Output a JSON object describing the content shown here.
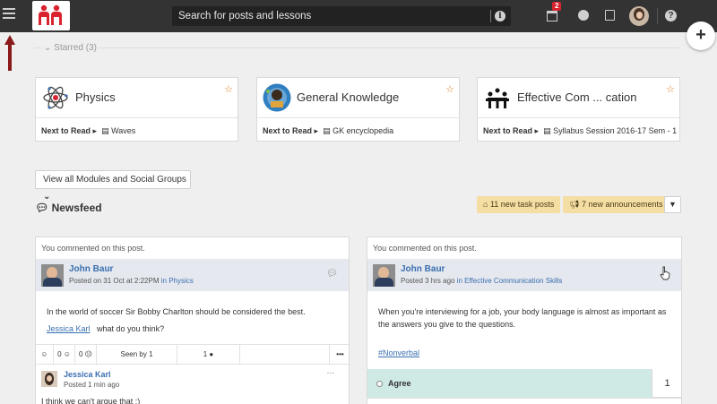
{
  "header": {
    "search_placeholder": "Search for posts and lessons",
    "calendar_badge": "2"
  },
  "starred": {
    "label": "Starred (3)",
    "modules": [
      {
        "title": "Physics",
        "next_label": "Next to Read",
        "next_item": "Waves"
      },
      {
        "title": "General Knowledge",
        "next_label": "Next to Read",
        "next_item": "GK encyclopedia"
      },
      {
        "title": "Effective Com ... cation",
        "next_label": "Next to Read",
        "next_item": "Syllabus Session 2016-17 Sem - 1"
      }
    ]
  },
  "view_all_label": "View all Modules and Social Groups",
  "newsfeed_label": "Newsfeed",
  "pills": {
    "tasks": "11 new task posts",
    "announcements": "7 new announcements"
  },
  "posts": [
    {
      "commented": "You commented on this post.",
      "author": "John Baur",
      "meta_prefix": "Posted on 31 Oct at 2:22PM",
      "meta_in": "in Physics",
      "body_line1": "In the world of soccer Sir Bobby Charlton should be considered the best.",
      "mention": "Jessica Karl",
      "body_line2": "what do you think?",
      "actions": {
        "like": "0",
        "dislike": "0",
        "seen": "Seen by 1",
        "comments": "1",
        "more": "•••"
      },
      "comment": {
        "name": "Jessica Karl",
        "time": "Posted 1 min ago",
        "text": "I think we can't argue that :)",
        "more": "..."
      }
    },
    {
      "commented": "You commented on this post.",
      "author": "John Baur",
      "meta_prefix": "Posted 3 hrs ago",
      "meta_in": "in Effective Communication Skills",
      "body": "When you're interviewing for a job, your body language is almost as important as the answers you give to the questions.",
      "hashtag": "#Nonverbal",
      "poll": {
        "option": "Agree",
        "count": "1"
      }
    }
  ],
  "colors": {
    "topbar": "#333333",
    "accent": "#d9232e",
    "pill_bg": "#f5dea3",
    "link": "#3a6fb0",
    "poll_bg": "#cfe9e5"
  }
}
